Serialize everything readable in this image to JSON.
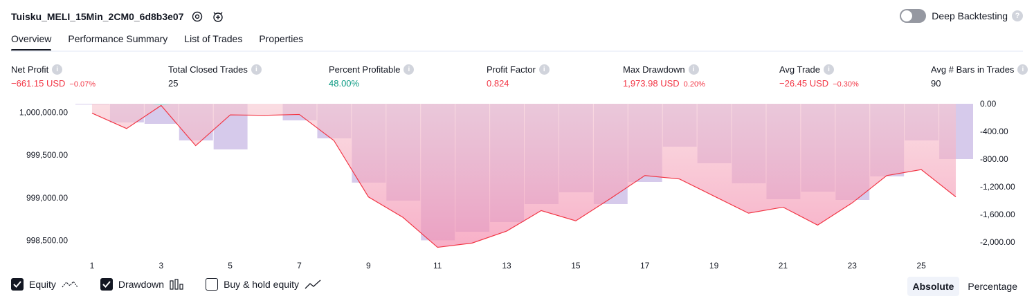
{
  "header": {
    "title": "Tuisku_MELI_15Min_2CM0_6d8b3e07",
    "deep_backtesting_label": "Deep Backtesting",
    "help_glyph": "?"
  },
  "tabs": [
    {
      "label": "Overview"
    },
    {
      "label": "Performance Summary"
    },
    {
      "label": "List of Trades"
    },
    {
      "label": "Properties"
    }
  ],
  "metrics": {
    "info_glyph": "i",
    "net_profit": {
      "label": "Net Profit",
      "value": "−661.15 USD",
      "pct": "−0.07%"
    },
    "total_closed_trades": {
      "label": "Total Closed Trades",
      "value": "25"
    },
    "percent_profitable": {
      "label": "Percent Profitable",
      "value": "48.00%"
    },
    "profit_factor": {
      "label": "Profit Factor",
      "value": "0.824"
    },
    "max_drawdown": {
      "label": "Max Drawdown",
      "value": "1,973.98 USD",
      "pct": "0.20%"
    },
    "avg_trade": {
      "label": "Avg Trade",
      "value": "−26.45 USD",
      "pct": "−0.30%"
    },
    "avg_bars": {
      "label": "Avg # Bars in Trades",
      "value": "90"
    }
  },
  "chart_data": {
    "type": "bar",
    "left_axis": {
      "ticks": [
        "1,000,000.00",
        "999,500.00",
        "999,000.00",
        "998,500.00"
      ],
      "tick_values": [
        1000000,
        999500,
        999000,
        998500
      ],
      "range": [
        998400,
        1000100
      ]
    },
    "right_axis": {
      "ticks": [
        "0.00",
        "-400.00",
        "-800.00",
        "-1,200.00",
        "-1,600.00",
        "-2,000.00"
      ],
      "tick_values": [
        0,
        -400,
        -800,
        -1200,
        -1600,
        -2000
      ],
      "range": [
        -2100,
        0
      ]
    },
    "x_ticks": [
      "1",
      "3",
      "5",
      "7",
      "9",
      "11",
      "13",
      "15",
      "17",
      "19",
      "21",
      "23",
      "25"
    ],
    "x_tick_values": [
      1,
      3,
      5,
      7,
      9,
      11,
      13,
      15,
      17,
      19,
      21,
      23,
      25
    ],
    "series": [
      {
        "name": "Equity",
        "type": "line",
        "x": [
          1,
          2,
          3,
          4,
          5,
          6,
          7,
          8,
          9,
          10,
          11,
          12,
          13,
          14,
          15,
          16,
          17,
          18,
          19,
          20,
          21,
          22,
          23,
          24,
          25,
          26
        ],
        "values": [
          999990,
          999810,
          1000080,
          999610,
          999970,
          999965,
          999975,
          999670,
          999010,
          998770,
          998420,
          998470,
          998610,
          998850,
          998730,
          998990,
          999260,
          999220,
          999020,
          998820,
          998890,
          998680,
          998940,
          999260,
          999330,
          999010
        ]
      },
      {
        "name": "Drawdown",
        "type": "bar",
        "x": [
          1,
          2,
          3,
          4,
          5,
          6,
          7,
          8,
          9,
          10,
          11,
          12,
          13,
          14,
          15,
          16,
          17,
          18,
          19,
          20,
          21,
          22,
          23,
          24,
          25,
          26
        ],
        "values": [
          -10,
          -270,
          -290,
          -530,
          -660,
          0,
          -240,
          -500,
          -1140,
          -1400,
          -1974,
          -1850,
          -1710,
          -1450,
          -1280,
          -1450,
          -1130,
          -620,
          -860,
          -1150,
          -1380,
          -1270,
          -1390,
          -1050,
          -530,
          -800
        ]
      }
    ]
  },
  "legend": {
    "equity": "Equity",
    "drawdown": "Drawdown",
    "buy_hold": "Buy & hold equity"
  },
  "mode": {
    "absolute": "Absolute",
    "percentage": "Percentage"
  },
  "colors": {
    "loss": "#f23645",
    "profit": "#089981",
    "drawdown_bar": "#d1c4e9",
    "equity_fill": "#f7a1b4",
    "equity_line": "#f23645"
  }
}
